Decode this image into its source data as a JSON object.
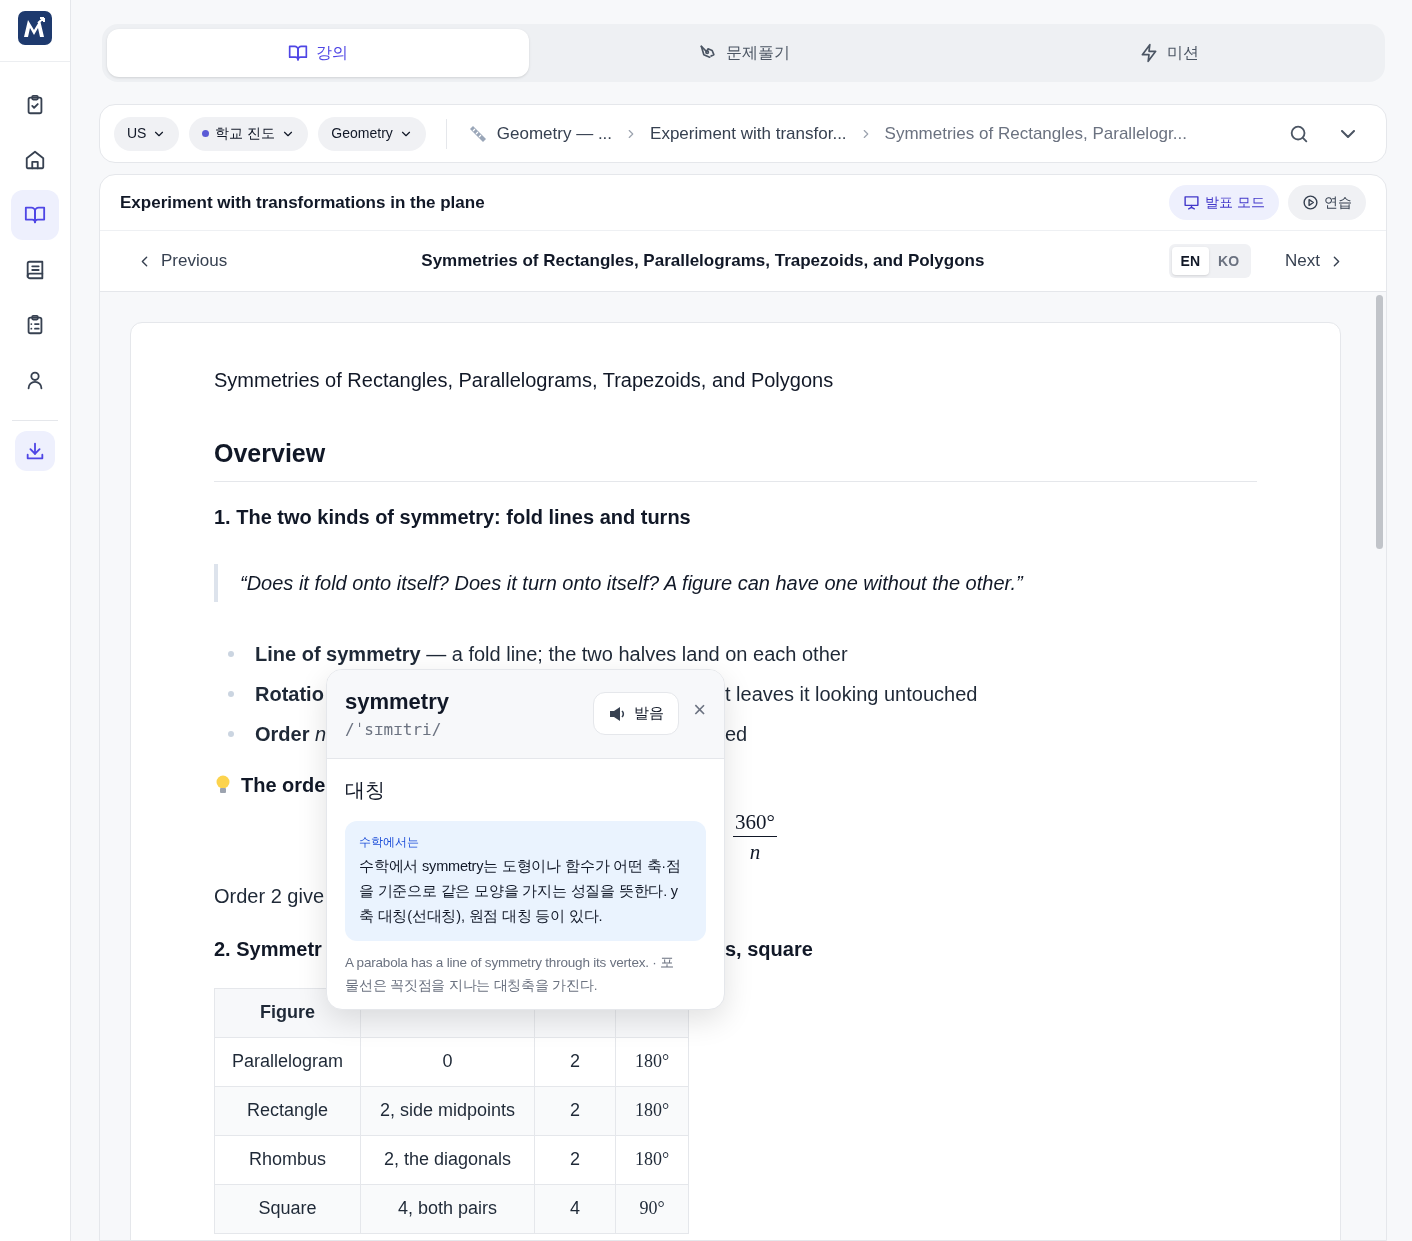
{
  "sidebar": {
    "items": [
      {
        "selected": false
      },
      {
        "selected": false
      },
      {
        "selected": true
      },
      {
        "selected": false
      },
      {
        "selected": false
      },
      {
        "selected": false
      },
      {
        "kind": "action"
      }
    ]
  },
  "tabs": [
    {
      "label": "강의",
      "selected": true
    },
    {
      "label": "문제풀기",
      "selected": false
    },
    {
      "label": "미션",
      "selected": false
    }
  ],
  "filters": [
    {
      "label": "US"
    },
    {
      "label": "학교 진도",
      "color": "#5b5bd6"
    },
    {
      "label": "Geometry"
    }
  ],
  "breadcrumb": [
    "Geometry — ...",
    "Experiment with transfor...",
    "Symmetries of Rectangles, Parallelogr..."
  ],
  "unit_header": {
    "title": "Experiment with transformations in the plane",
    "buttons": [
      {
        "label": "발표 모드",
        "kind": "primary"
      },
      {
        "label": "연습",
        "kind": "secondary"
      }
    ]
  },
  "lesson_nav": {
    "previous": "Previous",
    "title": "Symmetries of Rectangles, Parallelograms, Trapezoids, and Polygons",
    "languages": [
      {
        "label": "EN",
        "selected": true
      },
      {
        "label": "KO",
        "selected": false
      }
    ],
    "next": "Next"
  },
  "document": {
    "title": "Symmetries of Rectangles, Parallelograms, Trapezoids, and Polygons",
    "heading": "Overview",
    "section_1": "1. The two kinds of symmetry: fold lines and turns",
    "quote": "“Does it fold onto itself? Does it turn onto itself? A figure can have one without the other.”",
    "bullets": [
      {
        "text": "**Line of symmetry** — a fold line; the two halves land on each other"
      },
      {
        "text": "**Rotatio**",
        "text_right": "t leaves it looking untouched"
      },
      {
        "text": "**Order** *n*",
        "text_right": "ed"
      }
    ],
    "tip": "The orde",
    "formula": {
      "numerator": "360°",
      "denominator": "n"
    },
    "paragraph": "Order 2 give",
    "section_2": {
      "text": "2. Symmetr",
      "text_right": "s, square"
    },
    "table": {
      "columns": [
        "Figure"
      ],
      "rows": [
        [
          "Parallelogram",
          "0",
          "2",
          "180°"
        ],
        [
          "Rectangle",
          "2, side midpoints",
          "2",
          "180°"
        ],
        [
          "Rhombus",
          "2, the diagonals",
          "2",
          "180°"
        ],
        [
          "Square",
          "4, both pairs",
          "4",
          "90°"
        ]
      ]
    }
  },
  "popup": {
    "word": "symmetry",
    "ipa": "/ˈsɪmɪtri/",
    "pronounce": "발음",
    "close": "×",
    "meaning": "대칭",
    "note_label": "수학에서는",
    "note": "수학에서 symmetry는 도형이나 함수가 어떤 축·점을 기준으로 같은 모양을 가지는 성질을 뜻한다. y축 대칭(선대칭), 원점 대칭 등이 있다.",
    "example": "A parabola has a line of symmetry through its vertex. · 포물선은 꼭짓점을 지나는 대칭축을 가진다."
  }
}
